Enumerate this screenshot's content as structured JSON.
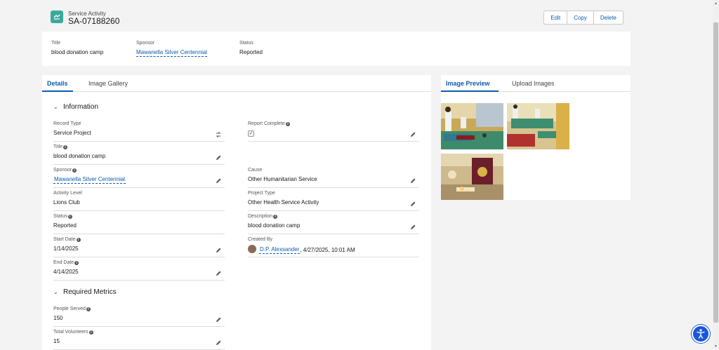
{
  "header": {
    "object_type": "Service Activity",
    "record_name": "SA-07188260",
    "buttons": {
      "edit": "Edit",
      "copy": "Copy",
      "delete": "Delete"
    }
  },
  "highlights": [
    {
      "label": "Title",
      "value": "blood donation camp"
    },
    {
      "label": "Sponsor",
      "value": "Mawanella Silver Centennial"
    },
    {
      "label": "Status",
      "value": "Reported"
    }
  ],
  "left_tabs": {
    "details": "Details",
    "gallery": "Image Gallery"
  },
  "sections": {
    "information": "Information",
    "metrics": "Required Metrics"
  },
  "info_fields": {
    "record_type": {
      "label": "Record Type",
      "value": "Service Project"
    },
    "title": {
      "label": "Title",
      "value": "blood donation camp"
    },
    "sponsor": {
      "label": "Sponsor",
      "value": "Mawanella Silver Centennial"
    },
    "activity_level": {
      "label": "Activity Level",
      "value": "Lions Club"
    },
    "status": {
      "label": "Status",
      "value": "Reported"
    },
    "start_date": {
      "label": "Start Date",
      "value": "1/14/2025"
    },
    "end_date": {
      "label": "End Date",
      "value": "4/14/2025"
    },
    "report_complete": {
      "label": "Report Complete",
      "checked": true
    },
    "cause": {
      "label": "Cause",
      "value": "Other Humanitarian Service"
    },
    "project_type": {
      "label": "Project Type",
      "value": "Other Health Service Activity"
    },
    "description": {
      "label": "Description",
      "value": "blood donation camp"
    },
    "created_by": {
      "label": "Created By",
      "user": "D.P. Alexsander",
      "date": ", 4/27/2025, 10:01 AM"
    }
  },
  "metric_fields": {
    "people_served": {
      "label": "People Served",
      "value": "150"
    },
    "total_volunteers": {
      "label": "Total Volunteers",
      "value": "15"
    }
  },
  "right_tabs": {
    "preview": "Image Preview",
    "upload": "Upload Images"
  },
  "colors": {
    "brand": "#0b5cab",
    "icon_bg": "#3ba99c",
    "a11y": "#1a56db"
  }
}
